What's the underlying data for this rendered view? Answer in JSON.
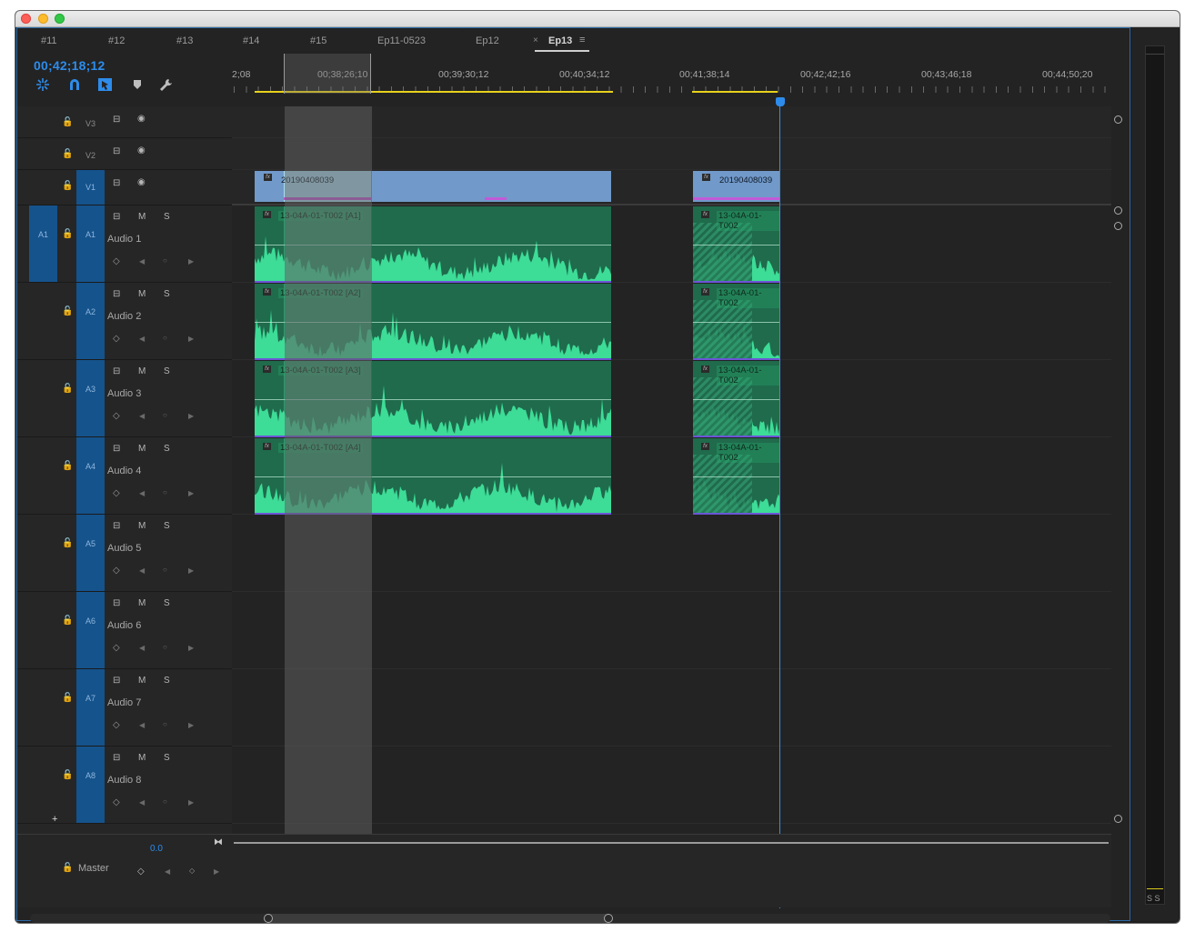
{
  "tabs": [
    {
      "label": "#11"
    },
    {
      "label": "#12"
    },
    {
      "label": "#13"
    },
    {
      "label": "#14"
    },
    {
      "label": "#15"
    },
    {
      "label": "Ep11-0523"
    },
    {
      "label": "Ep12"
    },
    {
      "label": "Ep13",
      "active": true
    }
  ],
  "tab_close_glyph": "×",
  "tab_menu_glyph": "≡",
  "timecode": "00;42;18;12",
  "toolbar": {
    "icons": [
      "nest-sequence-icon",
      "snap-magnet-icon",
      "linked-selection-icon",
      "add-marker-icon",
      "wrench-settings-icon"
    ],
    "accent_color": "#2d8ceb"
  },
  "ruler": {
    "labels": [
      "2;08",
      "00;38;26;10",
      "00;39;30;12",
      "00;40;34;12",
      "00;41;38;14",
      "00;42;42;16",
      "00;43;46;18",
      "00;44;50;20"
    ]
  },
  "video_tracks": [
    {
      "id": "V3",
      "toggle_glyph": "⊟",
      "eye_glyph": "◉"
    },
    {
      "id": "V2",
      "toggle_glyph": "⊟",
      "eye_glyph": "◉"
    },
    {
      "id": "V1",
      "toggle_glyph": "⊟",
      "eye_glyph": "◉"
    }
  ],
  "audio_tracks": [
    {
      "id": "A1",
      "name": "Audio 1",
      "mute": "M",
      "solo": "S",
      "source": "A1"
    },
    {
      "id": "A2",
      "name": "Audio 2",
      "mute": "M",
      "solo": "S"
    },
    {
      "id": "A3",
      "name": "Audio 3",
      "mute": "M",
      "solo": "S"
    },
    {
      "id": "A4",
      "name": "Audio 4",
      "mute": "M",
      "solo": "S"
    },
    {
      "id": "A5",
      "name": "Audio 5",
      "mute": "M",
      "solo": "S"
    },
    {
      "id": "A6",
      "name": "Audio 6",
      "mute": "M",
      "solo": "S"
    },
    {
      "id": "A7",
      "name": "Audio 7",
      "mute": "M",
      "solo": "S"
    },
    {
      "id": "A8",
      "name": "Audio 8",
      "mute": "M",
      "solo": "S"
    }
  ],
  "keyframe_glyphs": {
    "add": "◇",
    "prev": "◀",
    "next": "▶",
    "dot": "○"
  },
  "lock_glyph": "🔓",
  "video_clips": [
    {
      "label": "20190408039"
    },
    {
      "label": "20190408039"
    }
  ],
  "audio_clips": [
    {
      "label": "13-04A-01-T002 [A1]"
    },
    {
      "label": "13-04A-01-T002 [A2]"
    },
    {
      "label": "13-04A-01-T002 [A3]"
    },
    {
      "label": "13-04A-01-T002 [A4]"
    }
  ],
  "audio_clips_right": [
    {
      "label": "13-04A-01-T002"
    },
    {
      "label": "13-04A-01-T002"
    },
    {
      "label": "13-04A-01-T002"
    },
    {
      "label": "13-04A-01-T002"
    }
  ],
  "master": {
    "label": "Master",
    "volume": "0.0"
  },
  "meter_labels": "S S",
  "colors": {
    "video_clip": "#7199c9",
    "audio_clip": "#1f6b4c",
    "waveform": "#3ddc97",
    "track_target": "#15538c",
    "playhead": "#3f8de0",
    "work_area": "#e8d21a"
  }
}
